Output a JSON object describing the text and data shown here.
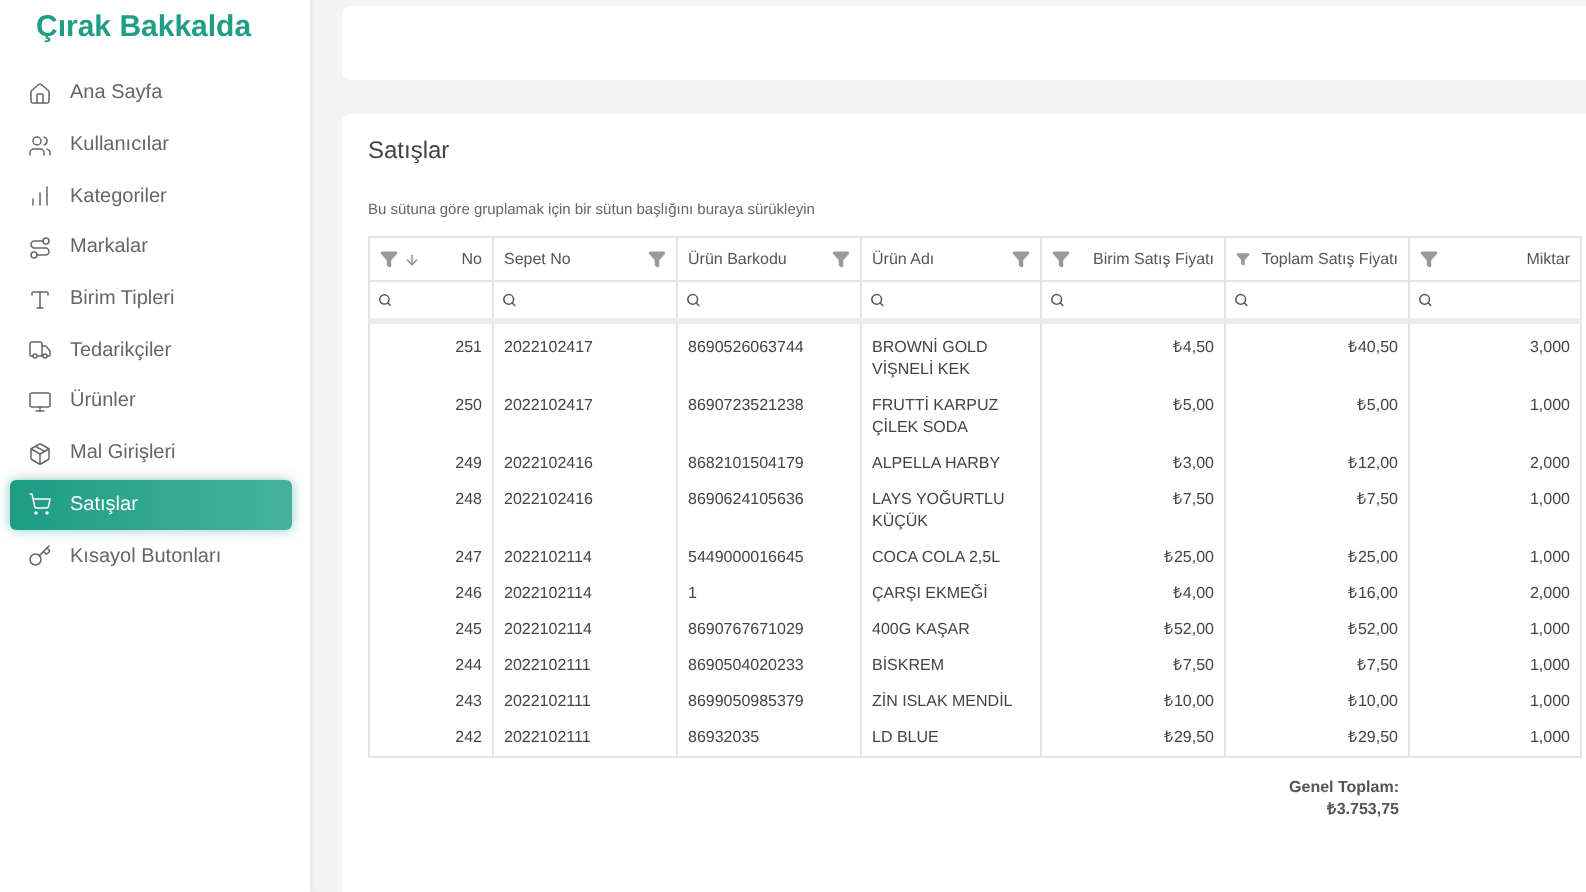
{
  "brand": "Çırak Bakkalda",
  "sidebar": {
    "items": [
      {
        "label": "Ana Sayfa",
        "selected": false
      },
      {
        "label": "Kullanıcılar",
        "selected": false
      },
      {
        "label": "Kategoriler",
        "selected": false
      },
      {
        "label": "Markalar",
        "selected": false
      },
      {
        "label": "Birim Tipleri",
        "selected": false
      },
      {
        "label": "Tedarikçiler",
        "selected": false
      },
      {
        "label": "Ürünler",
        "selected": false
      },
      {
        "label": "Mal Girişleri",
        "selected": false
      },
      {
        "label": "Satışlar",
        "selected": true
      },
      {
        "label": "Kısayol Butonları",
        "selected": false
      }
    ]
  },
  "panel": {
    "title": "Satışlar",
    "group_hint": "Bu sütuna göre gruplamak için bir sütun başlığını buraya sürükleyin"
  },
  "table": {
    "columns": [
      {
        "label": "No",
        "kind": "number",
        "sorted": true
      },
      {
        "label": "Sepet No",
        "kind": "text",
        "sorted": false
      },
      {
        "label": "Ürün Barkodu",
        "kind": "text",
        "sorted": false
      },
      {
        "label": "Ürün Adı",
        "kind": "text",
        "sorted": false
      },
      {
        "label": "Birim Satış Fiyatı",
        "kind": "number",
        "sorted": false
      },
      {
        "label": "Toplam Satış Fiyatı",
        "kind": "number",
        "sorted": false
      },
      {
        "label": "Miktar",
        "kind": "number",
        "sorted": false
      }
    ],
    "rows": [
      [
        "251",
        "2022102417",
        "8690526063744",
        "BROWNİ GOLD VİŞNELİ KEK",
        "₺4,50",
        "₺40,50",
        "3,000"
      ],
      [
        "250",
        "2022102417",
        "8690723521238",
        "FRUTTİ KARPUZ ÇİLEK SODA",
        "₺5,00",
        "₺5,00",
        "1,000"
      ],
      [
        "249",
        "2022102416",
        "8682101504179",
        "ALPELLA HARBY",
        "₺3,00",
        "₺12,00",
        "2,000"
      ],
      [
        "248",
        "2022102416",
        "8690624105636",
        "LAYS YOĞURTLU KÜÇÜK",
        "₺7,50",
        "₺7,50",
        "1,000"
      ],
      [
        "247",
        "2022102114",
        "5449000016645",
        "COCA COLA 2,5L",
        "₺25,00",
        "₺25,00",
        "1,000"
      ],
      [
        "246",
        "2022102114",
        "1",
        "ÇARŞI EKMEĞİ",
        "₺4,00",
        "₺16,00",
        "2,000"
      ],
      [
        "245",
        "2022102114",
        "8690767671029",
        "400G KAŞAR",
        "₺52,00",
        "₺52,00",
        "1,000"
      ],
      [
        "244",
        "2022102111",
        "8690504020233",
        "BİSKREM",
        "₺7,50",
        "₺7,50",
        "1,000"
      ],
      [
        "243",
        "2022102111",
        "8699050985379",
        "ZİN ISLAK MENDİL",
        "₺10,00",
        "₺10,00",
        "1,000"
      ],
      [
        "242",
        "2022102111",
        "86932035",
        "LD BLUE",
        "₺29,50",
        "₺29,50",
        "1,000"
      ]
    ],
    "summary": {
      "label": "Genel Toplam:",
      "value": "₺3.753,75"
    }
  }
}
